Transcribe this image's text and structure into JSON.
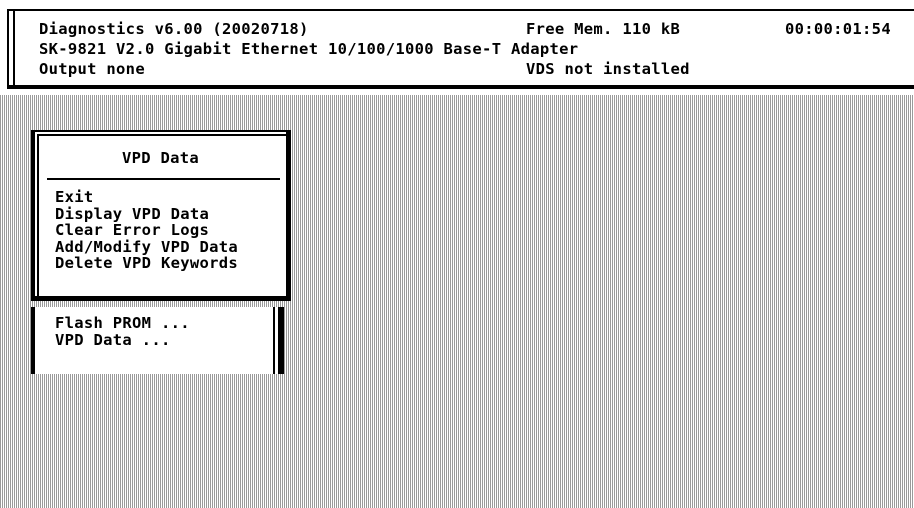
{
  "header": {
    "line1": "Diagnostics v6.00 (20020718)",
    "line2": "SK-9821 V2.0 Gigabit Ethernet 10/100/1000 Base-T Adapter",
    "line3": "Output none",
    "free_mem": "Free Mem. 110 kB",
    "clock": "00:00:01:54",
    "vds_status": "VDS not installed"
  },
  "menu": {
    "title": "VPD Data",
    "items": [
      "Exit",
      "Display VPD Data",
      "Clear Error Logs",
      "Add/Modify VPD Data",
      "Delete VPD Keywords"
    ]
  },
  "submenu": {
    "items": [
      "Flash PROM ...",
      "VPD Data ..."
    ]
  }
}
